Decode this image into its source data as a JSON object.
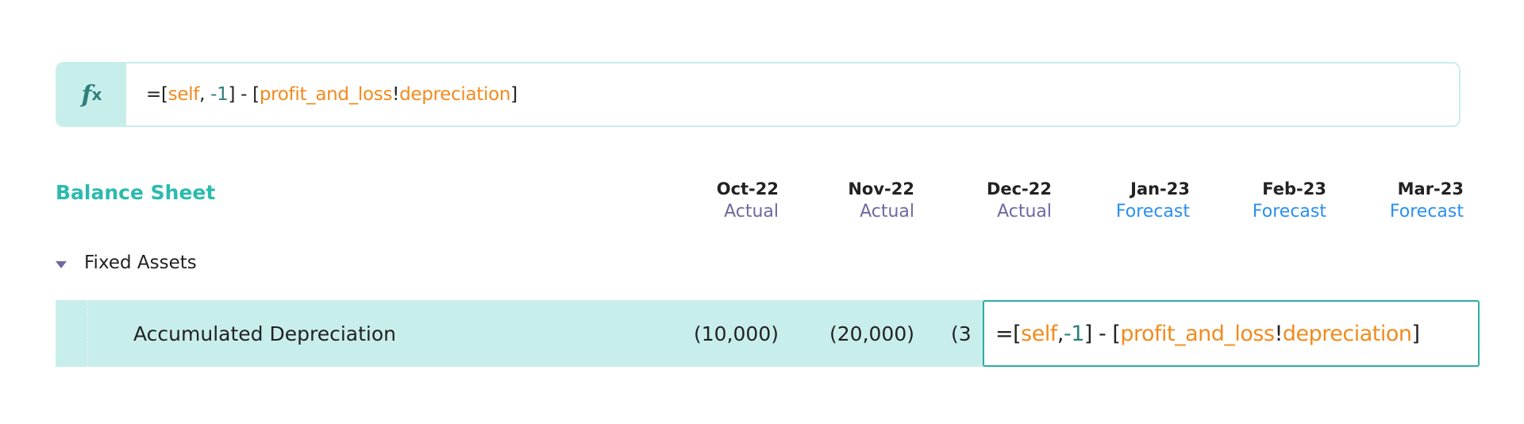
{
  "formula_bar": {
    "icon": "fx-icon",
    "icon_text": "f",
    "icon_sub": "x",
    "parts": [
      "=[",
      "self",
      ", ",
      "-1",
      "] - [",
      "profit_and_loss",
      "!",
      "depreciation",
      "]"
    ]
  },
  "sheet": {
    "title": "Balance Sheet",
    "columns": [
      {
        "date": "Oct-22",
        "status": "Actual"
      },
      {
        "date": "Nov-22",
        "status": "Actual"
      },
      {
        "date": "Dec-22",
        "status": "Actual"
      },
      {
        "date": "Jan-23",
        "status": "Forecast"
      },
      {
        "date": "Feb-23",
        "status": "Forecast"
      },
      {
        "date": "Mar-23",
        "status": "Forecast"
      }
    ],
    "group": {
      "label": "Fixed Assets",
      "expanded": true
    },
    "row": {
      "label": "Accumulated Depreciation",
      "values": [
        "(10,000)",
        "(20,000)",
        "(3"
      ]
    }
  },
  "cell_editor": {
    "parts": [
      "=[",
      "self",
      ",",
      "-1",
      "] - [",
      "profit_and_loss",
      "!",
      "depreciation",
      "]"
    ]
  },
  "colors": {
    "accent": "#2bbbad",
    "reference": "#f28a1c",
    "actual": "#6c6aa0",
    "forecast": "#2a8ff0",
    "selected_row": "#c8eeec"
  }
}
